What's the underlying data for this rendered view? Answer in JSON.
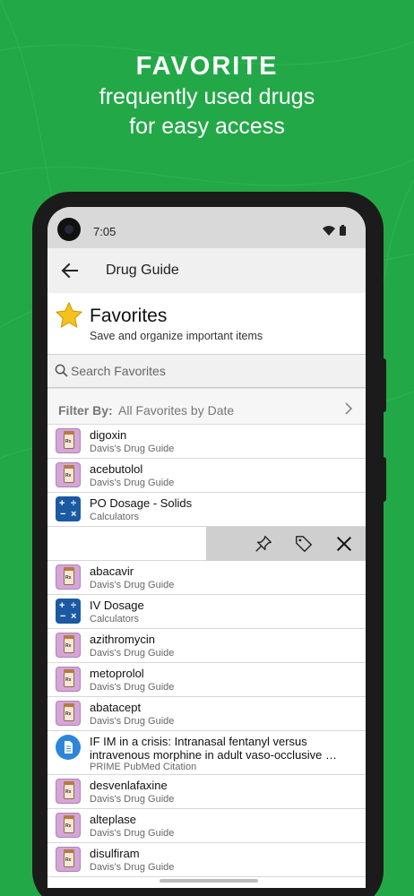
{
  "promo": {
    "title": "FAVORITE",
    "line1": "frequently used drugs",
    "line2": "for easy access"
  },
  "status_bar": {
    "time": "7:05",
    "icons": [
      "wifi-icon",
      "battery-icon"
    ]
  },
  "app_bar": {
    "title": "Drug Guide",
    "back_icon": "arrow-left-icon"
  },
  "favorites_header": {
    "icon": "star-icon",
    "title": "Favorites",
    "subtitle": "Save and organize important items"
  },
  "search": {
    "placeholder": "Search Favorites",
    "value": ""
  },
  "filter": {
    "label": "Filter By:",
    "value": "All Favorites by Date"
  },
  "items": [
    {
      "title": "digoxin",
      "subtitle": "Davis's Drug Guide",
      "icon": "rx-bottle-icon"
    },
    {
      "title": "acebutolol",
      "subtitle": "Davis's Drug Guide",
      "icon": "rx-bottle-icon"
    },
    {
      "title": "PO Dosage - Solids",
      "subtitle": "Calculators",
      "icon": "calculator-icon"
    },
    {
      "title": "abacavir",
      "subtitle": "Davis's Drug Guide",
      "icon": "rx-bottle-icon"
    },
    {
      "title": "IV Dosage",
      "subtitle": "Calculators",
      "icon": "calculator-icon"
    },
    {
      "title": "azithromycin",
      "subtitle": "Davis's Drug Guide",
      "icon": "rx-bottle-icon"
    },
    {
      "title": "metoprolol",
      "subtitle": "Davis's Drug Guide",
      "icon": "rx-bottle-icon"
    },
    {
      "title": "abatacept",
      "subtitle": "Davis's Drug Guide",
      "icon": "rx-bottle-icon"
    },
    {
      "title": "IF IM in a crisis: Intranasal fentanyl versus intravenous morphine in adult vaso-occlusive …",
      "subtitle": "PRIME PubMed Citation",
      "icon": "document-icon"
    },
    {
      "title": "desvenlafaxine",
      "subtitle": "Davis's Drug Guide",
      "icon": "rx-bottle-icon"
    },
    {
      "title": "alteplase",
      "subtitle": "Davis's Drug Guide",
      "icon": "rx-bottle-icon"
    },
    {
      "title": "disulfiram",
      "subtitle": "Davis's Drug Guide",
      "icon": "rx-bottle-icon"
    }
  ],
  "rx_label": "Rx",
  "swipe_actions": [
    "pin-icon",
    "tag-icon",
    "close-icon"
  ],
  "colors": {
    "background": "#22a847",
    "calculator": "#1b5aa2",
    "rx": "#d4a6d8",
    "document": "#2e86d9"
  }
}
